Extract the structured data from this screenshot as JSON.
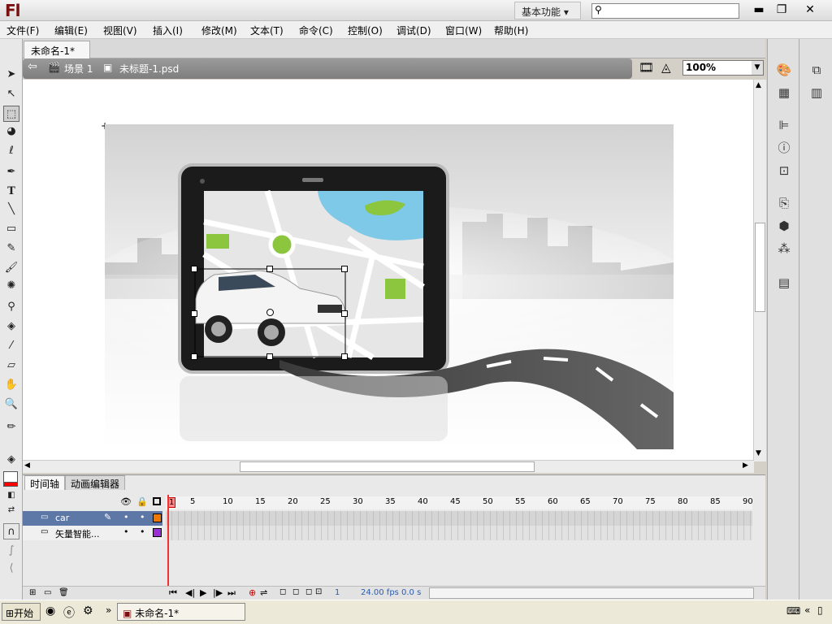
{
  "app": {
    "logo": "Fl",
    "workspace": "基本功能",
    "search_placeholder": ""
  },
  "window_buttons": {
    "minimize": "▬",
    "restore": "❐",
    "close": "✕"
  },
  "menu": [
    "文件(F)",
    "编辑(E)",
    "视图(V)",
    "插入(I)",
    "修改(M)",
    "文本(T)",
    "命令(C)",
    "控制(O)",
    "调试(D)",
    "窗口(W)",
    "帮助(H)"
  ],
  "document": {
    "tab": "未命名-1*",
    "close": "×"
  },
  "breadcrumb": {
    "scene": "场景 1",
    "symbol": "未标题-1.psd"
  },
  "zoom": "100%",
  "timeline": {
    "tabs": [
      "时间轴",
      "动画编辑器"
    ],
    "ruler": [
      "1",
      "5",
      "10",
      "15",
      "20",
      "25",
      "30",
      "35",
      "40",
      "45",
      "50",
      "55",
      "60",
      "65",
      "70",
      "75",
      "80",
      "85",
      "90"
    ],
    "layers": [
      {
        "name": "car",
        "color": "#f07800",
        "selected": true
      },
      {
        "name": "矢量智能...",
        "color": "#9a2fd6",
        "selected": false
      }
    ],
    "status": {
      "frame": "1",
      "fps": "24.00 fps",
      "time": "0.0 s"
    }
  },
  "taskbar": {
    "start": "开始",
    "window": "未命名-1*"
  },
  "colors": {
    "stroke_swatch": "#ff0000",
    "accent": "#5d78a6"
  }
}
